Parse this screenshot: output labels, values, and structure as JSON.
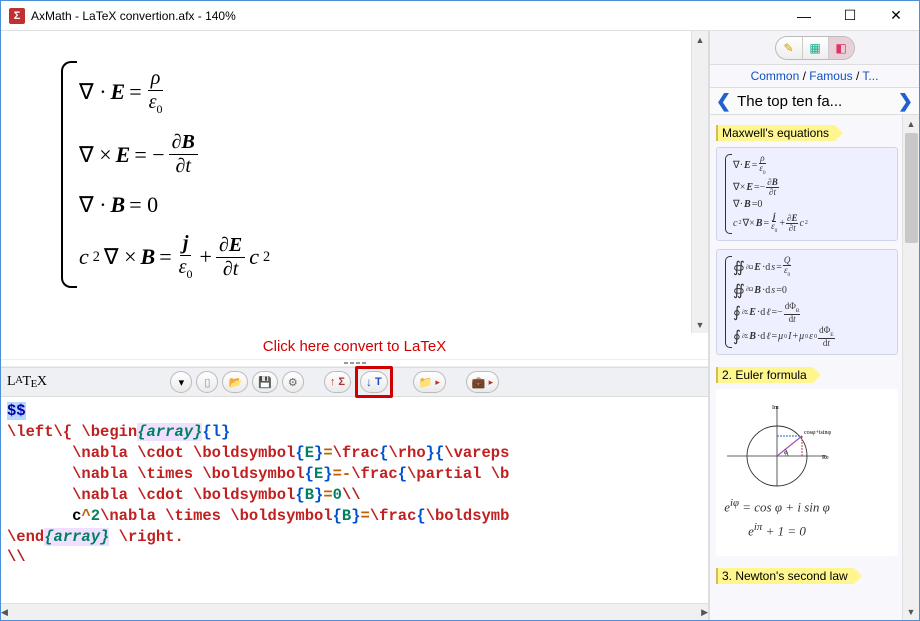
{
  "titlebar": {
    "icon_text": "Σ",
    "title": "AxMath - LaTeX convertion.afx - 140%"
  },
  "winbtns": {
    "min": "—",
    "max": "☐",
    "close": "✕"
  },
  "hint": "Click here convert to LaTeX",
  "toolbar": {
    "latex_label": "LATEX",
    "btn_dropdown": "▾",
    "btn_up_sigma": "↑Σ",
    "btn_down_T": "↓T"
  },
  "code": {
    "dollars": "$$",
    "l1_left": "\\left\\{ ",
    "l1_begin": "\\begin",
    "l1_env": "{array}",
    "l1_arg": "{l}",
    "ind": "       ",
    "l2_a": "\\nabla \\cdot \\boldsymbol",
    "l2_b": "{",
    "l2_c": "E",
    "l2_d": "}",
    "l2_e": "=",
    "l2_f": "\\frac",
    "l2_g": "{",
    "l2_h": "\\rho",
    "l2_i": "}{",
    "l2_j": "\\vareps",
    "l3_a": "\\nabla \\times \\boldsymbol",
    "l3_b": "{",
    "l3_c": "E",
    "l3_d": "}",
    "l3_e": "=-",
    "l3_f": "\\frac",
    "l3_g": "{",
    "l3_h": "\\partial \\b",
    "l4_a": "\\nabla \\cdot \\boldsymbol",
    "l4_b": "{",
    "l4_c": "B",
    "l4_d": "}",
    "l4_e": "=",
    "l4_f": "0",
    "l4_g": "\\\\",
    "l5_a": "c",
    "l5_b": "^",
    "l5_c": "2",
    "l5_d": "\\nabla \\times \\boldsymbol",
    "l5_e": "{",
    "l5_f": "B",
    "l5_g": "}",
    "l5_h": "=",
    "l5_i": "\\frac",
    "l5_j": "{",
    "l5_k": "\\boldsymb",
    "l6_end": "\\end",
    "l6_env": "{array}",
    "l6_right": " \\right.",
    "l7": "\\\\"
  },
  "sidebar": {
    "breadcrumb": {
      "a": "Common",
      "sep": " / ",
      "b": "Famous",
      "c": "T..."
    },
    "nav_title": "The top ten fa...",
    "items": [
      {
        "label": "Maxwell's equations"
      },
      {
        "label": "2. Euler formula"
      },
      {
        "label": "3. Newton's second law"
      }
    ],
    "euler_eq1": "e^{iφ} = cos φ + i sin φ",
    "euler_eq2": "e^{iπ} + 1 = 0",
    "euler_annot": "cosφ+isinφ"
  }
}
